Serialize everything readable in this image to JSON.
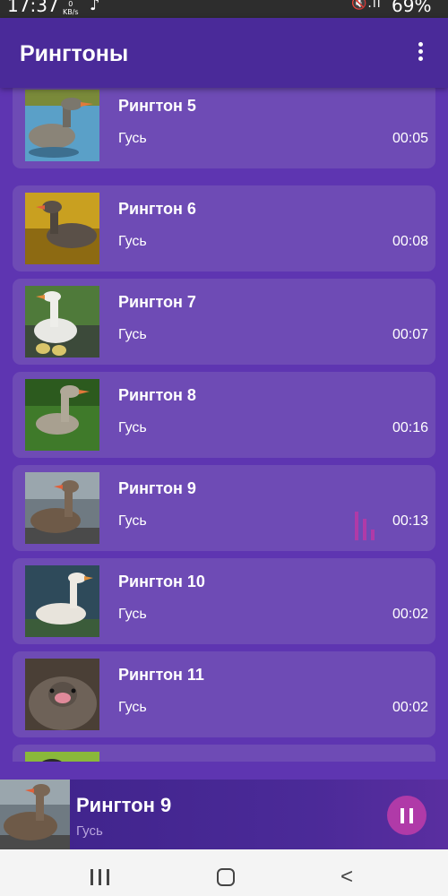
{
  "status_bar": {
    "time": "17:37",
    "net_speed_value": "0",
    "net_speed_unit": "KB/s",
    "battery": "69%",
    "icons": [
      "music-note-icon",
      "mute-icon",
      "wifi-icon",
      "signal-icon"
    ]
  },
  "app_bar": {
    "title": "Рингтоны",
    "menu_icon": "more-vert-icon"
  },
  "ringtones": [
    {
      "name": "Рингтон 5",
      "artist": "Гусь",
      "duration": "00:05",
      "playing": false
    },
    {
      "name": "Рингтон 6",
      "artist": "Гусь",
      "duration": "00:08",
      "playing": false
    },
    {
      "name": "Рингтон 7",
      "artist": "Гусь",
      "duration": "00:07",
      "playing": false
    },
    {
      "name": "Рингтон 8",
      "artist": "Гусь",
      "duration": "00:16",
      "playing": false
    },
    {
      "name": "Рингтон 9",
      "artist": "Гусь",
      "duration": "00:13",
      "playing": true
    },
    {
      "name": "Рингтон 10",
      "artist": "Гусь",
      "duration": "00:02",
      "playing": false
    },
    {
      "name": "Рингтон 11",
      "artist": "Гусь",
      "duration": "00:02",
      "playing": false
    }
  ],
  "now_playing": {
    "title": "Рингтон 9",
    "artist": "Гусь",
    "button_icon": "pause-icon"
  },
  "colors": {
    "background": "#5e35b1",
    "app_bar": "#4a2a99",
    "card": "#6e4bb5",
    "accent": "#b03aa8"
  }
}
